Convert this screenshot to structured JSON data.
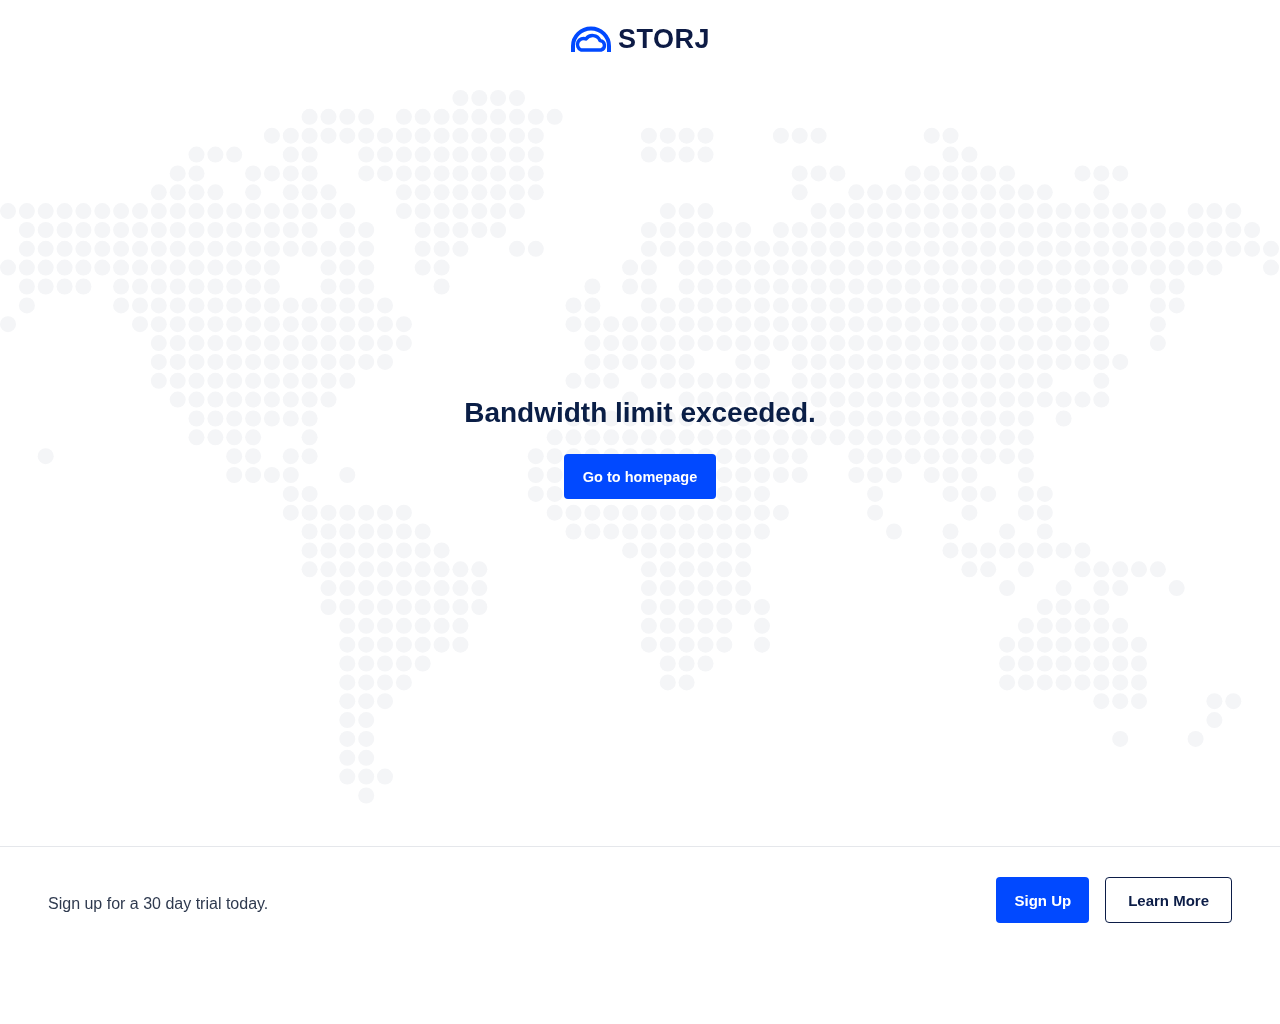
{
  "header": {
    "logo_text": "STORJ"
  },
  "main": {
    "headline": "Bandwidth limit exceeded.",
    "button": "Go to homepage"
  },
  "footer": {
    "message": "Sign up for a 30 day trial today.",
    "buttons": [
      {
        "label": "Sign Up",
        "kind": "primary"
      },
      {
        "label": "Learn More",
        "kind": "outline"
      }
    ]
  }
}
